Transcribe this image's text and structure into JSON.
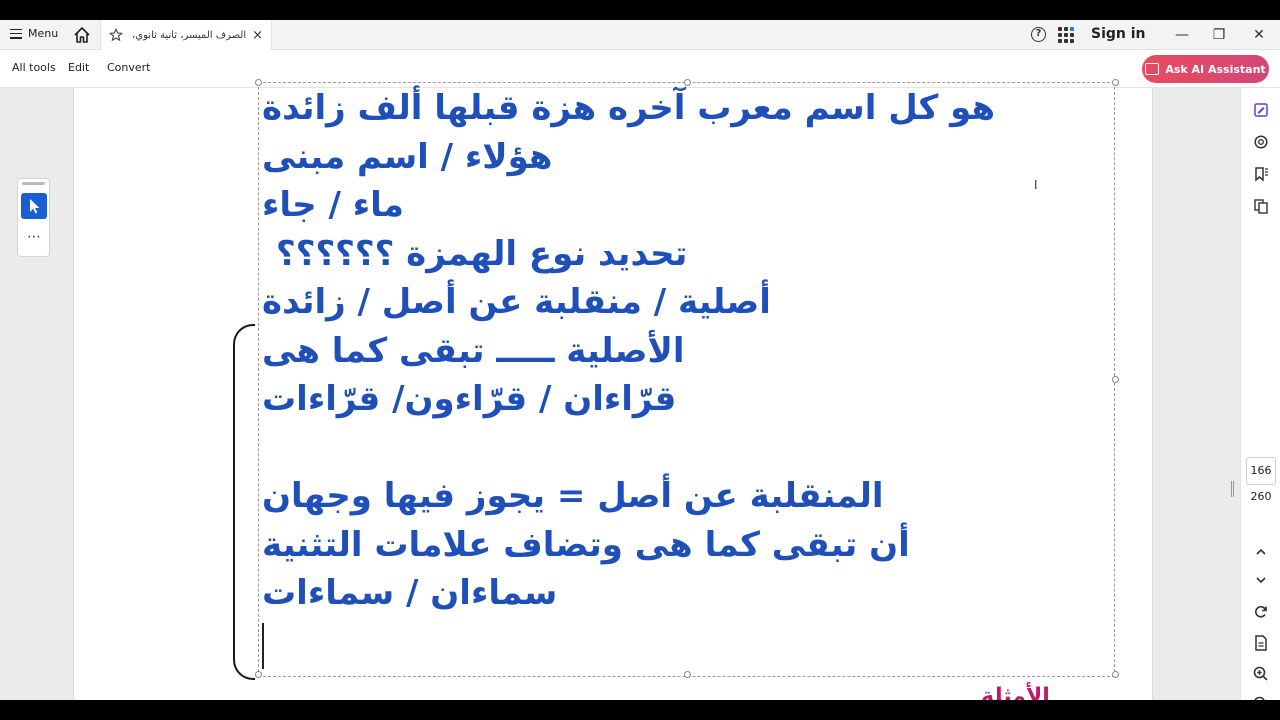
{
  "titlebar": {
    "menu_label": "Menu",
    "tab_title": "الصرف الميسر، ثانية ثانوي، ...",
    "tab_close": "×",
    "help_glyph": "?",
    "signin_label": "Sign in",
    "minimize": "—",
    "maximize": "❐",
    "close": "✕"
  },
  "toolbar": {
    "all_tools": "All tools",
    "edit": "Edit",
    "convert": "Convert",
    "ai_assistant": "Ask AI Assistant"
  },
  "document": {
    "lines": [
      "هو كل اسم معرب آخره هزة قبلها ألف زائدة",
      "هؤلاء / اسم مبنى",
      "ماء / جاء",
      "تحديد نوع الهمزة ؟؟؟؟؟؟",
      "أصلية / منقلبة عن أصل / زائدة",
      "الأصلية ـــــ تبقى كما هى",
      "قرّاءان / قرّاءون/ قرّاءات",
      "",
      "المنقلبة عن أصل = يجوز فيها وجهان",
      "أن تبقى كما هى وتضاف علامات التثنية",
      "سماءان / سماءات"
    ],
    "partial_heading": "الأمثلة",
    "text_color": "#1f4fb8",
    "accent_pink": "#c2186b"
  },
  "tools": {
    "more": "⋯"
  },
  "navigation": {
    "current_page": "166",
    "total_pages": "260"
  },
  "icons": [
    "home-icon",
    "star-icon",
    "help-icon",
    "apps-icon",
    "select-tool-icon",
    "ai-assistant-icon",
    "edit-pdf-icon",
    "comment-icon",
    "bookmark-icon",
    "pages-icon",
    "chevron-up-icon",
    "chevron-down-icon",
    "rotate-icon",
    "file-icon",
    "zoom-in-icon",
    "zoom-out-icon"
  ]
}
